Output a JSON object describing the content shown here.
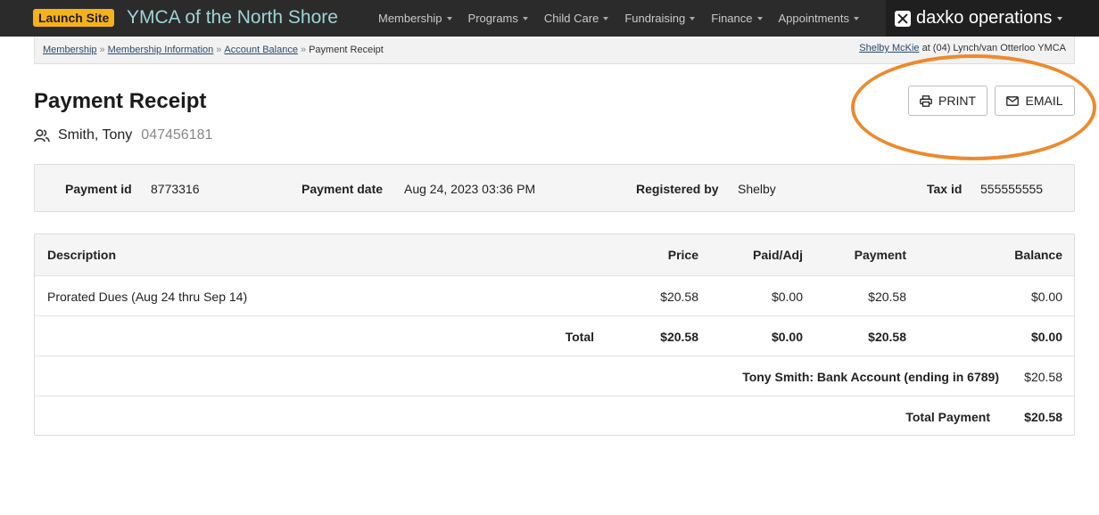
{
  "topnav": {
    "launch_label": "Launch Site",
    "org_name": "YMCA of the North Shore",
    "menu": [
      "Membership",
      "Programs",
      "Child Care",
      "Fundraising",
      "Finance",
      "Appointments"
    ],
    "brand": "daxko operations"
  },
  "breadcrumb": {
    "items": [
      "Membership",
      "Membership Information",
      "Account Balance"
    ],
    "current": "Payment Receipt",
    "separator": "»"
  },
  "user": {
    "name": "Shelby McKie",
    "location_text": "at (04) Lynch/van Otterloo YMCA"
  },
  "page": {
    "title": "Payment Receipt",
    "member_name": "Smith, Tony",
    "member_id": "047456181"
  },
  "actions": {
    "print_label": "PRINT",
    "email_label": "EMAIL"
  },
  "info": {
    "payment_id_label": "Payment id",
    "payment_id": "8773316",
    "payment_date_label": "Payment date",
    "payment_date": "Aug 24, 2023 03:36 PM",
    "registered_by_label": "Registered by",
    "registered_by": "Shelby",
    "tax_id_label": "Tax id",
    "tax_id": "555555555"
  },
  "table": {
    "headers": [
      "Description",
      "Price",
      "Paid/Adj",
      "Payment",
      "Balance"
    ],
    "rows": [
      {
        "description": "Prorated Dues (Aug 24 thru Sep 14)",
        "price": "$20.58",
        "paid_adj": "$0.00",
        "payment": "$20.58",
        "balance": "$0.00"
      }
    ],
    "total": {
      "label": "Total",
      "price": "$20.58",
      "paid_adj": "$0.00",
      "payment": "$20.58",
      "balance": "$0.00"
    },
    "method": {
      "label": "Tony Smith: Bank Account (ending in 6789)",
      "amount": "$20.58"
    },
    "total_payment": {
      "label": "Total Payment",
      "amount": "$20.58"
    }
  },
  "colors": {
    "nav_bg": "#2b2b2b",
    "launch_bg": "#f5b21b",
    "org_text": "#9fd3d6",
    "highlight": "#ec8a2f"
  }
}
